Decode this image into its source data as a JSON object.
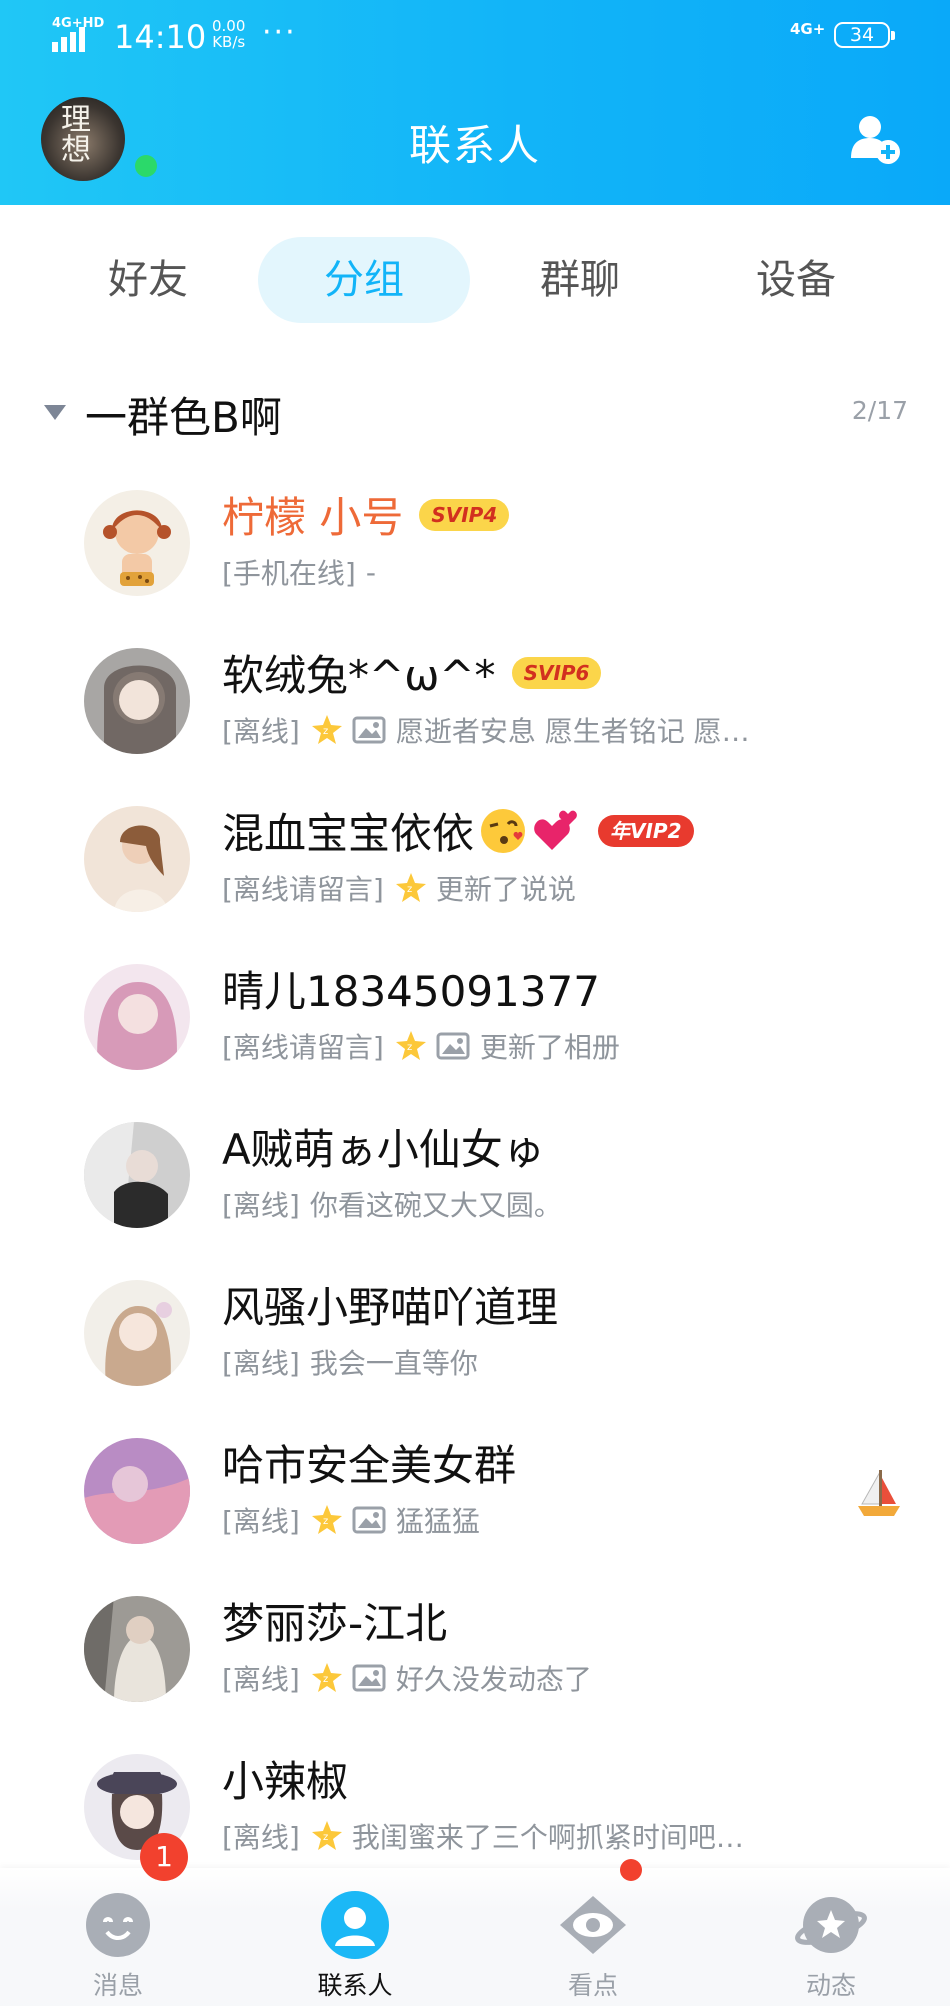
{
  "status_bar": {
    "network_label": "4G+HD",
    "time": "14:10",
    "speed_value": "0.00",
    "speed_unit": "KB/s",
    "more": "···",
    "net_type": "4G+",
    "battery": "34"
  },
  "header": {
    "title": "联系人",
    "avatar_text": "理想"
  },
  "tabs": [
    {
      "label": "好友",
      "active": false
    },
    {
      "label": "分组",
      "active": true
    },
    {
      "label": "群聊",
      "active": false
    },
    {
      "label": "设备",
      "active": false
    }
  ],
  "group": {
    "name": "一群色B啊",
    "count": "2/17"
  },
  "contacts": [
    {
      "name": "柠檬 小号",
      "badge": "SVIP4",
      "status": "[手机在线]",
      "message": "-"
    },
    {
      "name": "软绒兔*^ω^*",
      "badge": "SVIP6",
      "status": "[离线]",
      "message": "愿逝者安息 愿生者铭记 愿…"
    },
    {
      "name": "混血宝宝依依",
      "badge": "年VIP2",
      "status": "[离线请留言]",
      "message": "更新了说说"
    },
    {
      "name": "晴儿18345091377",
      "status": "[离线请留言]",
      "message": "更新了相册"
    },
    {
      "name": "A贼萌ぁ小仙女ゅ",
      "status": "[离线]",
      "message": "你看这碗又大又圆。"
    },
    {
      "name": "风骚小野喵吖道理",
      "status": "[离线]",
      "message": "我会一直等你"
    },
    {
      "name": "哈市安全美女群",
      "status": "[离线]",
      "message": "猛猛猛"
    },
    {
      "name": "梦丽莎-江北",
      "status": "[离线]",
      "message": "好久没发动态了"
    },
    {
      "name": "小辣椒",
      "status": "[离线]",
      "message": "我闺蜜来了三个啊抓紧时间吧…"
    }
  ],
  "bottom_nav": [
    {
      "label": "消息",
      "icon": "message-icon",
      "active": false
    },
    {
      "label": "联系人",
      "icon": "contacts-icon",
      "active": true
    },
    {
      "label": "看点",
      "icon": "eye-icon",
      "active": false
    },
    {
      "label": "动态",
      "icon": "planet-star-icon",
      "active": false
    }
  ],
  "unread_count": "1",
  "colors": {
    "brand_blue": "#12b4f8",
    "vip_name": "#ee6a38",
    "badge_red": "#f2412e",
    "online_green": "#2bd96a"
  }
}
